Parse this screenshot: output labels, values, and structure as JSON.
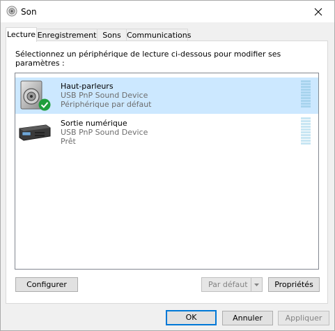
{
  "window": {
    "title": "Son"
  },
  "tabs": [
    {
      "label": "Lecture",
      "active": true
    },
    {
      "label": "Enregistrement",
      "active": false
    },
    {
      "label": "Sons",
      "active": false
    },
    {
      "label": "Communications",
      "active": false
    }
  ],
  "instruction": "Sélectionnez un périphérique de lecture ci-dessous pour modifier ses paramètres :",
  "devices": [
    {
      "name": "Haut-parleurs",
      "description": "USB PnP Sound Device",
      "status": "Périphérique par défaut",
      "selected": true,
      "icon": "speaker-icon",
      "badge": "default-checkmark-icon"
    },
    {
      "name": "Sortie numérique",
      "description": "USB PnP Sound Device",
      "status": "Prêt",
      "selected": false,
      "icon": "digital-output-icon"
    }
  ],
  "panel_buttons": {
    "configure": "Configurer",
    "set_default": "Par défaut",
    "properties": "Propriétés"
  },
  "dialog_buttons": {
    "ok": "OK",
    "cancel": "Annuler",
    "apply": "Appliquer"
  },
  "colors": {
    "selection": "#cce8ff",
    "accent": "#0078d7",
    "meter_selected": "#a8d4ee",
    "meter_idle": "#c8e6f3"
  }
}
